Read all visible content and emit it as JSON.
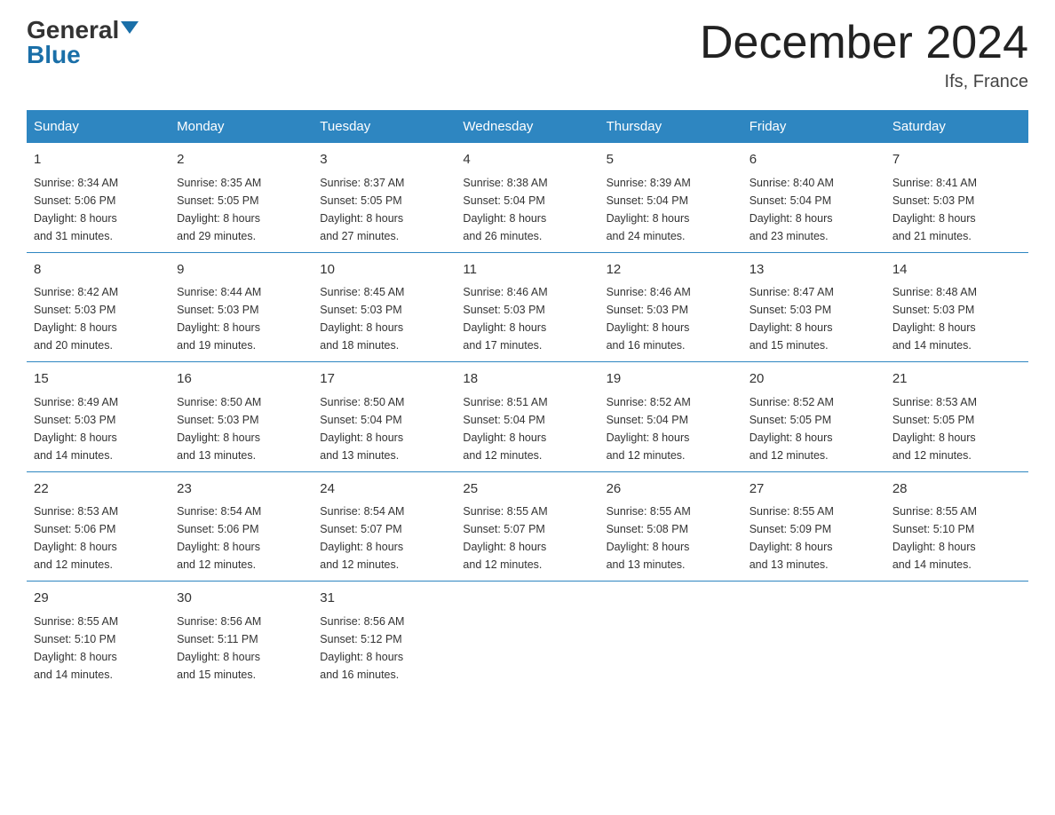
{
  "logo": {
    "general": "General",
    "blue": "Blue"
  },
  "title": "December 2024",
  "location": "Ifs, France",
  "days_of_week": [
    "Sunday",
    "Monday",
    "Tuesday",
    "Wednesday",
    "Thursday",
    "Friday",
    "Saturday"
  ],
  "weeks": [
    [
      {
        "day": "1",
        "sunrise": "8:34 AM",
        "sunset": "5:06 PM",
        "daylight": "8 hours and 31 minutes."
      },
      {
        "day": "2",
        "sunrise": "8:35 AM",
        "sunset": "5:05 PM",
        "daylight": "8 hours and 29 minutes."
      },
      {
        "day": "3",
        "sunrise": "8:37 AM",
        "sunset": "5:05 PM",
        "daylight": "8 hours and 27 minutes."
      },
      {
        "day": "4",
        "sunrise": "8:38 AM",
        "sunset": "5:04 PM",
        "daylight": "8 hours and 26 minutes."
      },
      {
        "day": "5",
        "sunrise": "8:39 AM",
        "sunset": "5:04 PM",
        "daylight": "8 hours and 24 minutes."
      },
      {
        "day": "6",
        "sunrise": "8:40 AM",
        "sunset": "5:04 PM",
        "daylight": "8 hours and 23 minutes."
      },
      {
        "day": "7",
        "sunrise": "8:41 AM",
        "sunset": "5:03 PM",
        "daylight": "8 hours and 21 minutes."
      }
    ],
    [
      {
        "day": "8",
        "sunrise": "8:42 AM",
        "sunset": "5:03 PM",
        "daylight": "8 hours and 20 minutes."
      },
      {
        "day": "9",
        "sunrise": "8:44 AM",
        "sunset": "5:03 PM",
        "daylight": "8 hours and 19 minutes."
      },
      {
        "day": "10",
        "sunrise": "8:45 AM",
        "sunset": "5:03 PM",
        "daylight": "8 hours and 18 minutes."
      },
      {
        "day": "11",
        "sunrise": "8:46 AM",
        "sunset": "5:03 PM",
        "daylight": "8 hours and 17 minutes."
      },
      {
        "day": "12",
        "sunrise": "8:46 AM",
        "sunset": "5:03 PM",
        "daylight": "8 hours and 16 minutes."
      },
      {
        "day": "13",
        "sunrise": "8:47 AM",
        "sunset": "5:03 PM",
        "daylight": "8 hours and 15 minutes."
      },
      {
        "day": "14",
        "sunrise": "8:48 AM",
        "sunset": "5:03 PM",
        "daylight": "8 hours and 14 minutes."
      }
    ],
    [
      {
        "day": "15",
        "sunrise": "8:49 AM",
        "sunset": "5:03 PM",
        "daylight": "8 hours and 14 minutes."
      },
      {
        "day": "16",
        "sunrise": "8:50 AM",
        "sunset": "5:03 PM",
        "daylight": "8 hours and 13 minutes."
      },
      {
        "day": "17",
        "sunrise": "8:50 AM",
        "sunset": "5:04 PM",
        "daylight": "8 hours and 13 minutes."
      },
      {
        "day": "18",
        "sunrise": "8:51 AM",
        "sunset": "5:04 PM",
        "daylight": "8 hours and 12 minutes."
      },
      {
        "day": "19",
        "sunrise": "8:52 AM",
        "sunset": "5:04 PM",
        "daylight": "8 hours and 12 minutes."
      },
      {
        "day": "20",
        "sunrise": "8:52 AM",
        "sunset": "5:05 PM",
        "daylight": "8 hours and 12 minutes."
      },
      {
        "day": "21",
        "sunrise": "8:53 AM",
        "sunset": "5:05 PM",
        "daylight": "8 hours and 12 minutes."
      }
    ],
    [
      {
        "day": "22",
        "sunrise": "8:53 AM",
        "sunset": "5:06 PM",
        "daylight": "8 hours and 12 minutes."
      },
      {
        "day": "23",
        "sunrise": "8:54 AM",
        "sunset": "5:06 PM",
        "daylight": "8 hours and 12 minutes."
      },
      {
        "day": "24",
        "sunrise": "8:54 AM",
        "sunset": "5:07 PM",
        "daylight": "8 hours and 12 minutes."
      },
      {
        "day": "25",
        "sunrise": "8:55 AM",
        "sunset": "5:07 PM",
        "daylight": "8 hours and 12 minutes."
      },
      {
        "day": "26",
        "sunrise": "8:55 AM",
        "sunset": "5:08 PM",
        "daylight": "8 hours and 13 minutes."
      },
      {
        "day": "27",
        "sunrise": "8:55 AM",
        "sunset": "5:09 PM",
        "daylight": "8 hours and 13 minutes."
      },
      {
        "day": "28",
        "sunrise": "8:55 AM",
        "sunset": "5:10 PM",
        "daylight": "8 hours and 14 minutes."
      }
    ],
    [
      {
        "day": "29",
        "sunrise": "8:55 AM",
        "sunset": "5:10 PM",
        "daylight": "8 hours and 14 minutes."
      },
      {
        "day": "30",
        "sunrise": "8:56 AM",
        "sunset": "5:11 PM",
        "daylight": "8 hours and 15 minutes."
      },
      {
        "day": "31",
        "sunrise": "8:56 AM",
        "sunset": "5:12 PM",
        "daylight": "8 hours and 16 minutes."
      },
      null,
      null,
      null,
      null
    ]
  ],
  "labels": {
    "sunrise": "Sunrise:",
    "sunset": "Sunset:",
    "daylight": "Daylight:"
  }
}
